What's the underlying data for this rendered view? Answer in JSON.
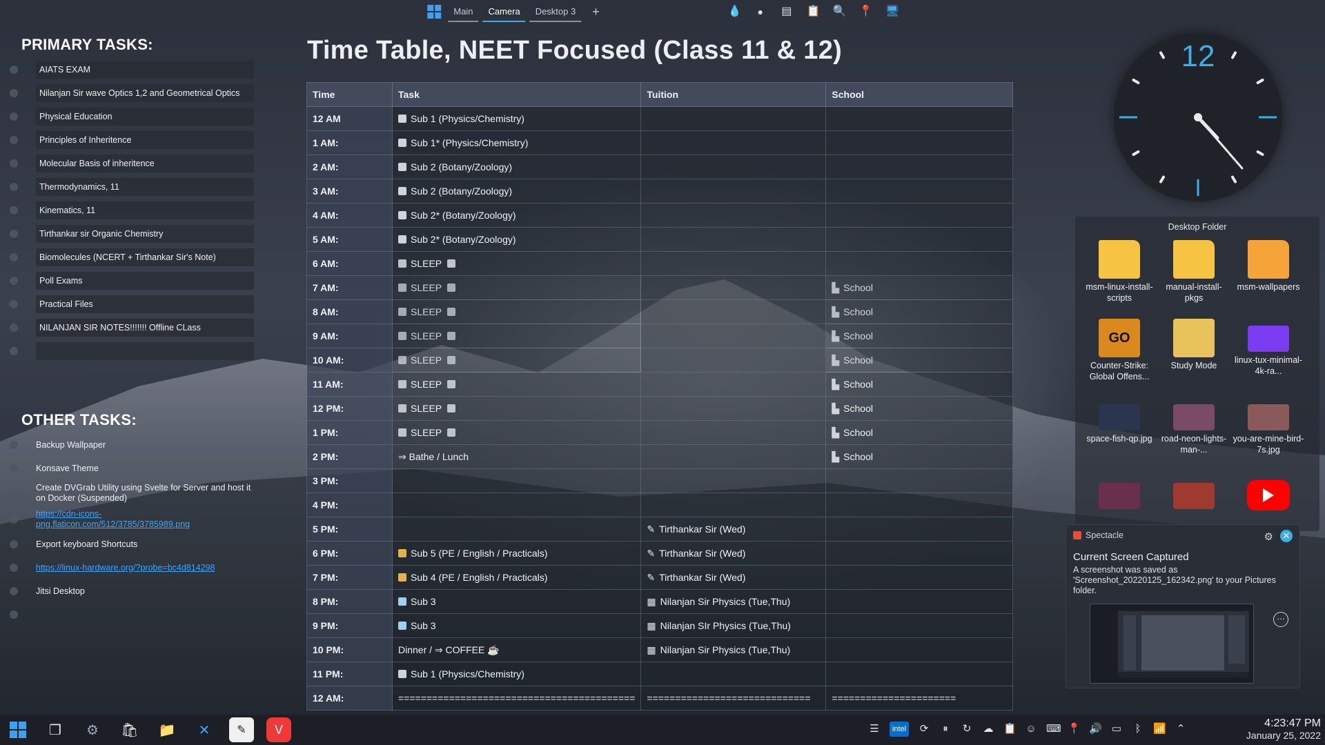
{
  "top_panel": {
    "tabs": [
      {
        "label": "Main",
        "active": false
      },
      {
        "label": "Camera",
        "active": true
      },
      {
        "label": "Desktop 3",
        "active": false
      }
    ],
    "add_label": "+"
  },
  "primary": {
    "title": "PRIMARY TASKS:",
    "items": [
      "AIATS EXAM",
      "Nilanjan Sir wave Optics 1,2 and Geometrical Optics",
      "Physical Education",
      "Principles of Inheritence",
      "Molecular Basis of inheritence",
      "Thermodynamics, 11",
      "Kinematics, 11",
      "Tirthankar sir Organic Chemistry",
      "Biomolecules (NCERT + Tirthankar Sir's Note)",
      "Poll Exams",
      "Practical Files",
      "NILANJAN SIR NOTES!!!!!!! Offline CLass",
      ""
    ]
  },
  "other": {
    "title": "OTHER TASKS:",
    "items": [
      {
        "text": "Backup Wallpaper",
        "link": false
      },
      {
        "text": "Konsave Theme",
        "link": false
      },
      {
        "text": "Create DVGrab Utility using Svelte for Server and host it on Docker (Suspended)",
        "link": false
      },
      {
        "text": "https://cdn-icons-png.flaticon.com/512/3785/3785989.png",
        "link": true
      },
      {
        "text": "Export keyboard Shortcuts",
        "link": false
      },
      {
        "text": "https://linux-hardware.org/?probe=bc4d814298",
        "link": true
      },
      {
        "text": "Jitsi Desktop",
        "link": false
      },
      {
        "text": "",
        "link": false
      }
    ]
  },
  "timetable": {
    "title": "Time Table, NEET Focused (Class 11 & 12)",
    "headers": [
      "Time",
      "Task",
      "Tuition",
      "School"
    ],
    "rows": [
      {
        "time": "12 AM",
        "task": "Sub 1 (Physics/Chemistry)",
        "task_icon": "#cfd3da",
        "tuition": "",
        "tuition_icon": "",
        "school": ""
      },
      {
        "time": "1 AM:",
        "task": "Sub 1* (Physics/Chemistry)",
        "task_icon": "#cfd3da",
        "tuition": "",
        "tuition_icon": "",
        "school": ""
      },
      {
        "time": "2 AM:",
        "task": "Sub 2 (Botany/Zoology)",
        "task_icon": "#cfd3da",
        "tuition": "",
        "tuition_icon": "",
        "school": ""
      },
      {
        "time": "3 AM:",
        "task": "Sub 2 (Botany/Zoology)",
        "task_icon": "#cfd3da",
        "tuition": "",
        "tuition_icon": "",
        "school": ""
      },
      {
        "time": "4 AM:",
        "task": "Sub 2* (Botany/Zoology)",
        "task_icon": "#cfd3da",
        "tuition": "",
        "tuition_icon": "",
        "school": ""
      },
      {
        "time": "5 AM:",
        "task": "Sub 2* (Botany/Zoology)",
        "task_icon": "#cfd3da",
        "tuition": "",
        "tuition_icon": "",
        "school": ""
      },
      {
        "time": "6 AM:",
        "task": "SLEEP",
        "task_icon": "#bfc4cc",
        "tuition": "",
        "tuition_icon": "",
        "school": ""
      },
      {
        "time": "7 AM:",
        "task": "SLEEP",
        "task_icon": "#bfc4cc",
        "tuition": "",
        "tuition_icon": "",
        "school": "School"
      },
      {
        "time": "8 AM:",
        "task": "SLEEP",
        "task_icon": "#bfc4cc",
        "tuition": "",
        "tuition_icon": "",
        "school": "School"
      },
      {
        "time": "9 AM:",
        "task": "SLEEP",
        "task_icon": "#bfc4cc",
        "tuition": "",
        "tuition_icon": "",
        "school": "School"
      },
      {
        "time": "10 AM:",
        "task": "SLEEP",
        "task_icon": "#bfc4cc",
        "tuition": "",
        "tuition_icon": "",
        "school": "School"
      },
      {
        "time": "11 AM:",
        "task": "SLEEP",
        "task_icon": "#bfc4cc",
        "tuition": "",
        "tuition_icon": "",
        "school": "School"
      },
      {
        "time": "12 PM:",
        "task": "SLEEP",
        "task_icon": "#bfc4cc",
        "tuition": "",
        "tuition_icon": "",
        "school": "School"
      },
      {
        "time": "1 PM:",
        "task": "SLEEP",
        "task_icon": "#bfc4cc",
        "tuition": "",
        "tuition_icon": "",
        "school": "School"
      },
      {
        "time": "2 PM:",
        "task": "⇒ Bathe / Lunch",
        "task_icon": "",
        "tuition": "",
        "tuition_icon": "",
        "school": "School"
      },
      {
        "time": "3 PM:",
        "task": "",
        "task_icon": "",
        "tuition": "",
        "tuition_icon": "",
        "school": ""
      },
      {
        "time": "4 PM:",
        "task": "",
        "task_icon": "",
        "tuition": "",
        "tuition_icon": "",
        "school": ""
      },
      {
        "time": "5 PM:",
        "task": "",
        "task_icon": "",
        "tuition": "Tirthankar Sir (Wed)",
        "tuition_icon": "✎",
        "school": ""
      },
      {
        "time": "6 PM:",
        "task": "Sub 5 (PE / English / Practicals)",
        "task_icon": "#e8b04a",
        "tuition": "Tirthankar Sir (Wed)",
        "tuition_icon": "✎",
        "school": ""
      },
      {
        "time": "7 PM:",
        "task": "Sub 4 (PE / English / Practicals)",
        "task_icon": "#e8b04a",
        "tuition": "Tirthankar Sir (Wed)",
        "tuition_icon": "✎",
        "school": ""
      },
      {
        "time": "8 PM:",
        "task": "Sub 3",
        "task_icon": "#9fd0f0",
        "tuition": "Nilanjan Sir Physics (Tue,Thu)",
        "tuition_icon": "▦",
        "school": ""
      },
      {
        "time": "9 PM:",
        "task": "Sub 3",
        "task_icon": "#9fd0f0",
        "tuition": "Nilanjan SIr Physics (Tue,Thu)",
        "tuition_icon": "▦",
        "school": ""
      },
      {
        "time": "10 PM:",
        "task": "Dinner / ⇒ COFFEE ☕",
        "task_icon": "",
        "tuition": "Nilanjan Sir Physics (Tue,Thu)",
        "tuition_icon": "▦",
        "school": ""
      },
      {
        "time": "11 PM:",
        "task": "Sub 1 (Physics/Chemistry)",
        "task_icon": "#cfd3da",
        "tuition": "",
        "tuition_icon": "",
        "school": ""
      },
      {
        "time": "12 AM:",
        "task": "==========================================",
        "task_icon": "",
        "tuition": "=============================",
        "tuition_icon": "",
        "school": "======================"
      }
    ]
  },
  "clock_widget": {
    "hour_label": "12"
  },
  "desktop_folder": {
    "title": "Desktop Folder",
    "items": [
      {
        "label": "msm-linux-install-scripts",
        "icon": "folder-icon",
        "color": "#f6c343"
      },
      {
        "label": "manual-install-pkgs",
        "icon": "folder-icon",
        "color": "#f6c343"
      },
      {
        "label": "msm-wallpapers",
        "icon": "folder-icon",
        "color": "#f6a43a"
      },
      {
        "label": "Counter-Strike: Global Offens...",
        "icon": "csgo-icon",
        "color": "#d9891e"
      },
      {
        "label": "Study Mode",
        "icon": "study-icon",
        "color": "#e8c25a"
      },
      {
        "label": "linux-tux-minimal-4k-ra...",
        "icon": "image-icon",
        "color": "#7a3cf0"
      },
      {
        "label": "space-fish-qp.jpg",
        "icon": "image-icon",
        "color": "#2a3550"
      },
      {
        "label": "road-neon-lights-man-...",
        "icon": "image-icon",
        "color": "#7a4a66"
      },
      {
        "label": "you-are-mine-bird-7s.jpg",
        "icon": "image-icon",
        "color": "#8a5a5a"
      },
      {
        "label": "",
        "icon": "image-icon",
        "color": "#6a2f4a"
      },
      {
        "label": "",
        "icon": "image-icon",
        "color": "#a03a30"
      },
      {
        "label": "",
        "icon": "youtube-icon",
        "color": "#ff0000"
      }
    ]
  },
  "notification": {
    "app": "Spectacle",
    "title": "Current Screen Captured",
    "body": "A screenshot was saved as 'Screenshot_20220125_162342.png' to your Pictures folder."
  },
  "taskbar": {
    "time": "4:23:47 PM",
    "date": "January 25, 2022",
    "intel_label": "intel"
  }
}
